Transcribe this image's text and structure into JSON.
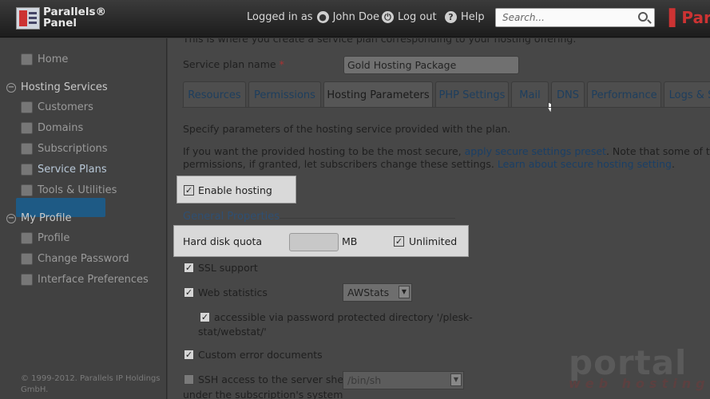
{
  "header": {
    "brand_line1": "Parallels®",
    "brand_line2": "Panel",
    "logged_in_as": "Logged in as",
    "user": "John Doe",
    "logout": "Log out",
    "help": "Help",
    "search_placeholder": "Search...",
    "plesk_brand": "Par"
  },
  "sidebar": {
    "home": "Home",
    "hosting_services": "Hosting Services",
    "customers": "Customers",
    "domains": "Domains",
    "subscriptions": "Subscriptions",
    "service_plans": "Service Plans",
    "tools": "Tools & Utilities",
    "my_profile": "My Profile",
    "profile": "Profile",
    "change_password": "Change Password",
    "interface_prefs": "Interface Preferences",
    "copyright": "© 1999-2012. Parallels IP Holdings GmbH."
  },
  "main": {
    "intro": "This is where you create a service plan corresponding to your hosting offering.",
    "plan_name_label": "Service plan name",
    "required_mark": "*",
    "plan_name_value": "Gold Hosting Package",
    "tabs": [
      "Resources",
      "Permissions",
      "Hosting Parameters",
      "PHP Settings",
      "Mail",
      "DNS",
      "Performance",
      "Logs & S"
    ],
    "desc1": "Specify parameters of the hosting service provided with the plan.",
    "desc2a": "If you want the provided hosting to be the most secure,",
    "desc2link": "apply secure settings preset",
    "desc2b": ". Note that some of the",
    "desc3a": "permissions, if granted, let subscribers change these settings.",
    "desc3link": "Learn about secure hosting setting",
    "enable_hosting": "Enable hosting",
    "general_props": "General Properties",
    "disk_quota": "Hard disk quota",
    "mb": "MB",
    "unlimited": "Unlimited",
    "ssl": "SSL support",
    "webstats": "Web statistics",
    "webstats_value": "AWStats",
    "webstat_access1": "accessible via password protected directory '/plesk-",
    "webstat_access2": "stat/webstat/'",
    "custom_errors": "Custom error documents",
    "ssh1": "SSH access to the server shell",
    "ssh2": "under the subscription's system",
    "shell_value": "/bin/sh",
    "check": "✓"
  },
  "watermark": {
    "main": "portal",
    "sub": "web hosting"
  }
}
